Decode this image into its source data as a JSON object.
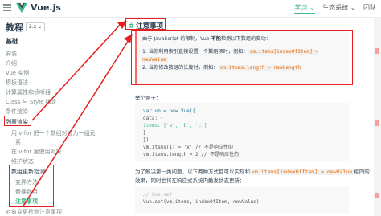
{
  "topbar": {
    "brand": "Vue.js",
    "nav": [
      "学习 ⌄",
      "生态系统 ⌄",
      "团队"
    ]
  },
  "sidebar": {
    "title": "教程",
    "version": "2.x ⌄",
    "section": "基础",
    "items": [
      "安装",
      "介绍",
      "Vue 实例",
      "模板语法",
      "计算属性和侦听器",
      "Class 与 Style 绑定",
      "条件渲染",
      "列表渲染"
    ],
    "subitems": [
      "用 v-for 把一个数组对应为一组元",
      "素",
      "在 v-for 里使用对象",
      "维护状态"
    ],
    "group_label": "数组更新检测",
    "group_items": [
      "变异方法",
      "替换数组",
      "注意事项"
    ],
    "last_item": "对象变更检测注意事项"
  },
  "main": {
    "heading_hash": "#",
    "heading": "注意事项",
    "notice": {
      "intro_a": "由于 JavaScript 的限制，Vue ",
      "intro_bold": "不能",
      "intro_b": "检测以下数组的变动：",
      "li1_text": "1. 当你利用索引直接设置一个数组项时，例如：",
      "li1_code": "vm.items[indexOfItem] = newValue",
      "li2_text": "2. 当你修改数组的长度时，例如：",
      "li2_code": "vm.items.length = newLength"
    },
    "example_label": "举个例子：",
    "code1": [
      {
        "t": "var vm = new Vue({",
        "cls": "k"
      },
      {
        "t": "  data: {",
        "cls": ""
      },
      {
        "t": "    items: ['a', 'b', 'c']",
        "cls": "s"
      },
      {
        "t": "  }",
        "cls": ""
      },
      {
        "t": "})",
        "cls": ""
      },
      {
        "t": "vm.items[1] = 'x' // 不是响应性的",
        "cls": ""
      },
      {
        "t": "vm.items.length = 2 // 不是响应性的",
        "cls": ""
      }
    ],
    "para2_a": "为了解决第一类问题，以下两种方式都可以实现和",
    "para2_code": "vm.items[indexOfItem] = newValue",
    "para2_b": "相同的",
    "para2_line2": "效果，同时也将在响应式系统内触发状态更新：",
    "code2": [
      {
        "t": "// Vue.set",
        "cls": "cm"
      },
      {
        "t": "Vue.set(vm.items, indexOfItem, newValue)",
        "cls": ""
      }
    ]
  }
}
